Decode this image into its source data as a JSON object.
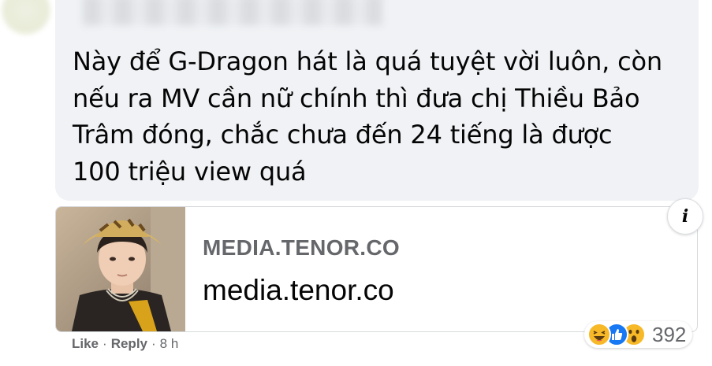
{
  "comment": {
    "text_lines": [
      "Này để G-Dragon hát là quá tuyệt vời luôn, còn",
      "nếu ra MV cần nữ chính thì đưa chị Thiều Bảo",
      "Trâm đóng, chắc chưa đến 24 tiếng là được",
      "100 triệu view quá"
    ]
  },
  "link_preview": {
    "domain_caps": "MEDIA.TENOR.CO",
    "title": "media.tenor.co",
    "info_glyph": "i"
  },
  "reactions": {
    "icons": [
      "haha-icon",
      "like-icon",
      "wow-icon"
    ],
    "count": "392"
  },
  "actions": {
    "like": "Like",
    "reply": "Reply",
    "separator": "·",
    "time": "8 h"
  },
  "colors": {
    "bubble": "#f0f2f5",
    "secondary_text": "#65676b",
    "primary_text": "#050505",
    "like_blue": "#1877f2",
    "reaction_yellow": "#f7b928"
  }
}
